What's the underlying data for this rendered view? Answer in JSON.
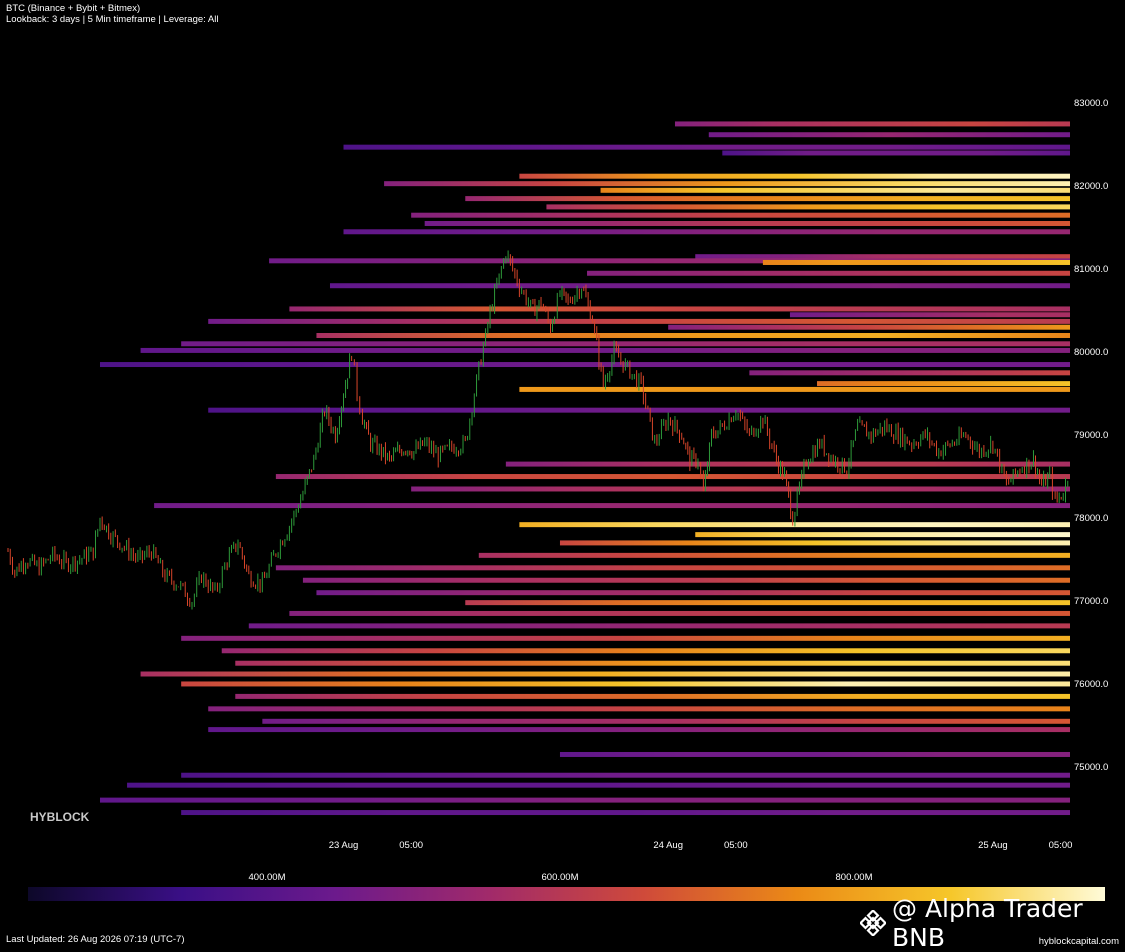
{
  "header": {
    "line1": "BTC (Binance + Bybit + Bitmex)",
    "line2": "Lookback: 3 days | 5 Min timeframe | Leverage: All"
  },
  "watermark": "HYBLOCK",
  "colorbar": {
    "labels": [
      "400.00M",
      "600.00M",
      "800.00M"
    ],
    "stops": [
      "#0d0829",
      "#3a0f86",
      "#6c1a8c",
      "#a12a6a",
      "#cf4a3a",
      "#eb8a16",
      "#f6c72a",
      "#fffbd8"
    ]
  },
  "footer": {
    "last_updated": "Last Updated: 26 Aug 2026 07:19 (UTC-7)",
    "site": "hyblockcapital.com"
  },
  "badge": {
    "text": "@ Alpha Trader BNB",
    "icon": "binance-logo-icon"
  },
  "chart_data": {
    "type": "heatmap",
    "title": "",
    "y_ticks": [
      "83000.0",
      "82000.0",
      "81000.0",
      "80000.0",
      "79000.0",
      "78000.0",
      "77000.0",
      "76000.0",
      "75000.0"
    ],
    "x_ticks": [
      "23 Aug",
      "05:00",
      "24 Aug",
      "05:00",
      "25 Aug",
      "05:00"
    ],
    "ylim": [
      74300,
      83400
    ],
    "x_range_hours": [
      -24.8,
      53.7
    ],
    "price_series": {
      "name": "BTC",
      "x_hours": [
        -24.8,
        -24.3,
        -23.5,
        -22.5,
        -21.5,
        -20.5,
        -19.5,
        -18.5,
        -18.0,
        -17.2,
        -16.2,
        -15.2,
        -14.2,
        -13.2,
        -12.2,
        -11.2,
        -10.5,
        -9.5,
        -8.6,
        -7.8,
        -7.0,
        -6.0,
        -5.0,
        -4.0,
        -3.0,
        -2.2,
        -1.4,
        -0.6,
        0,
        0.6,
        1.0,
        1.4,
        2.0,
        2.8,
        3.4,
        4.0,
        4.6,
        5.2,
        6.0,
        7.0,
        8.0,
        9.0,
        10.0,
        11.0,
        12.0,
        13.0,
        14.0,
        14.6,
        15.3,
        15.6,
        16.0,
        16.6,
        17.6,
        18.4,
        19.2,
        20.0,
        21.0,
        22.0,
        23.0,
        24.0,
        25.0,
        25.6,
        26.2,
        26.6,
        27.2,
        28.0,
        29.0,
        30.0,
        31.0,
        32.0,
        32.6,
        33.2,
        34.2,
        35.2,
        36.2,
        37.2,
        38.0,
        39.0,
        40.0,
        41.0,
        42.0,
        43.0,
        44.0,
        45.0,
        46.0,
        47.0,
        48.0,
        49.0,
        50.0,
        51.0,
        51.6,
        52.2,
        52.6,
        53.2,
        53.7
      ],
      "values": [
        77600,
        77350,
        77500,
        77400,
        77550,
        77450,
        77500,
        77600,
        78000,
        77800,
        77650,
        77500,
        77600,
        77300,
        77200,
        77000,
        77300,
        77100,
        77500,
        77700,
        77300,
        77200,
        77600,
        77900,
        78300,
        78700,
        79300,
        79000,
        79500,
        80000,
        79500,
        79200,
        78900,
        78800,
        78700,
        78800,
        78850,
        78800,
        78900,
        78750,
        78850,
        78900,
        79800,
        80600,
        81200,
        80800,
        80500,
        80600,
        80300,
        80500,
        80700,
        80600,
        80800,
        80400,
        79600,
        80000,
        79800,
        79600,
        78900,
        79200,
        79000,
        78700,
        78700,
        78300,
        79000,
        79100,
        79300,
        79000,
        79200,
        78700,
        78500,
        78000,
        78700,
        78900,
        78700,
        78600,
        79100,
        79000,
        79100,
        79000,
        78900,
        79000,
        78800,
        78900,
        79000,
        78800,
        78900,
        78400,
        78600,
        78700,
        78400,
        78500,
        78200,
        78300,
        78600
      ]
    },
    "colorbar_range": [
      200000000,
      1000000000
    ],
    "liquidity_bands": [
      {
        "price": 82750,
        "start_h": 24.5,
        "segs": [
          0.35,
          0.45,
          0.5,
          0.55,
          0.5
        ]
      },
      {
        "price": 82620,
        "start_h": 27,
        "segs": [
          0.3,
          0.35,
          0.4,
          0.35,
          0.3
        ]
      },
      {
        "price": 82470,
        "start_h": 0,
        "segs": [
          0.2,
          0.25,
          0.3,
          0.3,
          0.25
        ]
      },
      {
        "price": 82400,
        "start_h": 28,
        "segs": [
          0.2,
          0.3,
          0.3,
          0.3,
          0.25
        ]
      },
      {
        "price": 82120,
        "start_h": 13,
        "segs": [
          0.55,
          0.75,
          0.85,
          0.95,
          0.98
        ]
      },
      {
        "price": 82030,
        "start_h": 3,
        "segs": [
          0.35,
          0.55,
          0.75,
          0.9,
          0.97
        ]
      },
      {
        "price": 81950,
        "start_h": 19,
        "segs": [
          0.7,
          0.85,
          0.9,
          0.95,
          0.92
        ]
      },
      {
        "price": 81850,
        "start_h": 9,
        "segs": [
          0.4,
          0.6,
          0.7,
          0.8,
          0.85
        ]
      },
      {
        "price": 81750,
        "start_h": 15,
        "segs": [
          0.45,
          0.6,
          0.75,
          0.85,
          0.9
        ]
      },
      {
        "price": 81650,
        "start_h": 5,
        "segs": [
          0.35,
          0.45,
          0.55,
          0.6,
          0.65
        ]
      },
      {
        "price": 81550,
        "start_h": 6,
        "segs": [
          0.3,
          0.4,
          0.5,
          0.55,
          0.6
        ]
      },
      {
        "price": 81450,
        "start_h": 0,
        "segs": [
          0.25,
          0.3,
          0.35,
          0.4,
          0.4
        ]
      },
      {
        "price": 81150,
        "start_h": 26,
        "segs": [
          0.3,
          0.35,
          0.45,
          0.5,
          0.55
        ]
      },
      {
        "price": 81100,
        "start_h": -5.5,
        "segs": [
          0.3,
          0.35,
          0.4,
          0.4,
          0.35
        ]
      },
      {
        "price": 81080,
        "start_h": 31,
        "segs": [
          0.7,
          0.75,
          0.75,
          0.8,
          0.85
        ]
      },
      {
        "price": 80950,
        "start_h": 18,
        "segs": [
          0.35,
          0.4,
          0.45,
          0.5,
          0.55
        ]
      },
      {
        "price": 80800,
        "start_h": -1,
        "segs": [
          0.25,
          0.3,
          0.3,
          0.35,
          0.3
        ]
      },
      {
        "price": 80520,
        "start_h": -4,
        "segs": [
          0.4,
          0.6,
          0.55,
          0.5,
          0.45
        ]
      },
      {
        "price": 80450,
        "start_h": 33,
        "segs": [
          0.3,
          0.35,
          0.4,
          0.45,
          0.45
        ]
      },
      {
        "price": 80370,
        "start_h": -10,
        "segs": [
          0.3,
          0.45,
          0.55,
          0.6,
          0.5
        ]
      },
      {
        "price": 80300,
        "start_h": 24,
        "segs": [
          0.35,
          0.45,
          0.55,
          0.65,
          0.75
        ]
      },
      {
        "price": 80200,
        "start_h": -2,
        "segs": [
          0.45,
          0.65,
          0.75,
          0.8,
          0.7
        ]
      },
      {
        "price": 80100,
        "start_h": -12,
        "segs": [
          0.3,
          0.35,
          0.4,
          0.45,
          0.45
        ]
      },
      {
        "price": 80020,
        "start_h": -15,
        "segs": [
          0.25,
          0.3,
          0.3,
          0.35,
          0.35
        ]
      },
      {
        "price": 79850,
        "start_h": -18,
        "segs": [
          0.2,
          0.25,
          0.3,
          0.3,
          0.3
        ]
      },
      {
        "price": 79750,
        "start_h": 30,
        "segs": [
          0.35,
          0.4,
          0.45,
          0.5,
          0.55
        ]
      },
      {
        "price": 79620,
        "start_h": 35,
        "segs": [
          0.65,
          0.7,
          0.75,
          0.8,
          0.85
        ]
      },
      {
        "price": 79550,
        "start_h": 13,
        "segs": [
          0.75,
          0.75,
          0.75,
          0.75,
          0.75
        ]
      },
      {
        "price": 79300,
        "start_h": -10,
        "segs": [
          0.2,
          0.25,
          0.3,
          0.3,
          0.3
        ]
      },
      {
        "price": 78650,
        "start_h": 12,
        "segs": [
          0.35,
          0.45,
          0.5,
          0.5,
          0.45
        ]
      },
      {
        "price": 78500,
        "start_h": -5,
        "segs": [
          0.4,
          0.55,
          0.6,
          0.55,
          0.5
        ]
      },
      {
        "price": 78350,
        "start_h": 5,
        "segs": [
          0.35,
          0.45,
          0.5,
          0.45,
          0.4
        ]
      },
      {
        "price": 78150,
        "start_h": -14,
        "segs": [
          0.3,
          0.35,
          0.4,
          0.4,
          0.35
        ]
      },
      {
        "price": 77920,
        "start_h": 13,
        "segs": [
          0.8,
          0.9,
          0.95,
          0.98,
          0.97
        ]
      },
      {
        "price": 77800,
        "start_h": 26,
        "segs": [
          0.8,
          0.9,
          0.95,
          0.98,
          0.99
        ]
      },
      {
        "price": 77700,
        "start_h": 16,
        "segs": [
          0.55,
          0.7,
          0.85,
          0.92,
          0.97
        ]
      },
      {
        "price": 77550,
        "start_h": 10,
        "segs": [
          0.45,
          0.55,
          0.65,
          0.75,
          0.8
        ]
      },
      {
        "price": 77400,
        "start_h": -5,
        "segs": [
          0.35,
          0.45,
          0.55,
          0.6,
          0.65
        ]
      },
      {
        "price": 77250,
        "start_h": -3,
        "segs": [
          0.35,
          0.45,
          0.5,
          0.6,
          0.65
        ]
      },
      {
        "price": 77100,
        "start_h": -2,
        "segs": [
          0.3,
          0.4,
          0.45,
          0.55,
          0.6
        ]
      },
      {
        "price": 76980,
        "start_h": 9,
        "segs": [
          0.5,
          0.65,
          0.75,
          0.8,
          0.85
        ]
      },
      {
        "price": 76850,
        "start_h": -4,
        "segs": [
          0.35,
          0.45,
          0.5,
          0.55,
          0.6
        ]
      },
      {
        "price": 76700,
        "start_h": -7,
        "segs": [
          0.3,
          0.35,
          0.4,
          0.45,
          0.5
        ]
      },
      {
        "price": 76550,
        "start_h": -12,
        "segs": [
          0.35,
          0.45,
          0.55,
          0.7,
          0.8
        ]
      },
      {
        "price": 76400,
        "start_h": -9,
        "segs": [
          0.4,
          0.55,
          0.7,
          0.85,
          0.9
        ]
      },
      {
        "price": 76250,
        "start_h": -8,
        "segs": [
          0.45,
          0.6,
          0.75,
          0.88,
          0.92
        ]
      },
      {
        "price": 76120,
        "start_h": -15,
        "segs": [
          0.45,
          0.65,
          0.8,
          0.93,
          0.96
        ]
      },
      {
        "price": 76000,
        "start_h": -12,
        "segs": [
          0.55,
          0.7,
          0.85,
          0.97,
          0.95
        ]
      },
      {
        "price": 75850,
        "start_h": -8,
        "segs": [
          0.4,
          0.55,
          0.65,
          0.8,
          0.85
        ]
      },
      {
        "price": 75700,
        "start_h": -10,
        "segs": [
          0.35,
          0.45,
          0.55,
          0.65,
          0.7
        ]
      },
      {
        "price": 75550,
        "start_h": -6,
        "segs": [
          0.3,
          0.4,
          0.45,
          0.55,
          0.6
        ]
      },
      {
        "price": 75450,
        "start_h": -10,
        "segs": [
          0.25,
          0.3,
          0.35,
          0.4,
          0.45
        ]
      },
      {
        "price": 75150,
        "start_h": 16,
        "segs": [
          0.25,
          0.3,
          0.3,
          0.35,
          0.35
        ]
      },
      {
        "price": 74900,
        "start_h": -12,
        "segs": [
          0.2,
          0.25,
          0.3,
          0.3,
          0.3
        ]
      },
      {
        "price": 74780,
        "start_h": -16,
        "segs": [
          0.2,
          0.25,
          0.25,
          0.3,
          0.3
        ]
      },
      {
        "price": 74600,
        "start_h": -18,
        "segs": [
          0.25,
          0.3,
          0.35,
          0.35,
          0.35
        ]
      },
      {
        "price": 74450,
        "start_h": -12,
        "segs": [
          0.2,
          0.25,
          0.25,
          0.3,
          0.3
        ]
      }
    ]
  }
}
